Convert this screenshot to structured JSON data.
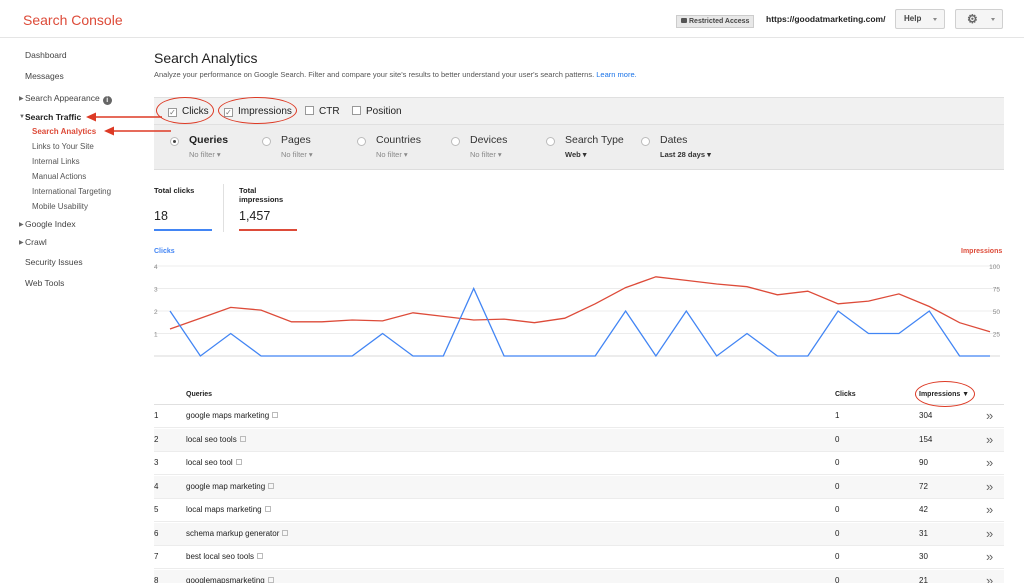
{
  "header": {
    "app_title": "Search Console",
    "restricted_label": "Restricted Access",
    "site_url": "https://goodatmarketing.com/",
    "help_label": "Help"
  },
  "sidebar": {
    "items": [
      {
        "label": "Dashboard"
      },
      {
        "label": "Messages"
      },
      {
        "label": "Search Appearance"
      },
      {
        "label": "Search Traffic"
      },
      {
        "label": "Search Analytics"
      },
      {
        "label": "Links to Your Site"
      },
      {
        "label": "Internal Links"
      },
      {
        "label": "Manual Actions"
      },
      {
        "label": "International Targeting"
      },
      {
        "label": "Mobile Usability"
      },
      {
        "label": "Google Index"
      },
      {
        "label": "Crawl"
      },
      {
        "label": "Security Issues"
      },
      {
        "label": "Web Tools"
      }
    ]
  },
  "main": {
    "title": "Search Analytics",
    "description": "Analyze your performance on Google Search. Filter and compare your site's results to better understand your user's search patterns.",
    "learn_more": "Learn more.",
    "metrics": [
      {
        "label": "Clicks",
        "checked": true
      },
      {
        "label": "Impressions",
        "checked": true
      },
      {
        "label": "CTR",
        "checked": false
      },
      {
        "label": "Position",
        "checked": false
      }
    ],
    "dimensions": [
      {
        "label": "Queries",
        "filter": "No filter",
        "selected": true
      },
      {
        "label": "Pages",
        "filter": "No filter",
        "selected": false
      },
      {
        "label": "Countries",
        "filter": "No filter",
        "selected": false
      },
      {
        "label": "Devices",
        "filter": "No filter",
        "selected": false
      },
      {
        "label": "Search Type",
        "filter": "Web",
        "selected": false
      },
      {
        "label": "Dates",
        "filter": "Last 28 days",
        "selected": false
      }
    ],
    "totals": {
      "clicks_label": "Total clicks",
      "clicks_value": "18",
      "impressions_label": "Total impressions",
      "impressions_value": "1,457"
    },
    "table": {
      "headers": {
        "queries": "Queries",
        "clicks": "Clicks",
        "impressions": "Impressions ▼"
      },
      "rows": [
        {
          "num": "1",
          "query": "google maps marketing",
          "clicks": "1",
          "impressions": "304"
        },
        {
          "num": "2",
          "query": "local seo tools",
          "clicks": "0",
          "impressions": "154"
        },
        {
          "num": "3",
          "query": "local seo tool",
          "clicks": "0",
          "impressions": "90"
        },
        {
          "num": "4",
          "query": "google map marketing",
          "clicks": "0",
          "impressions": "72"
        },
        {
          "num": "5",
          "query": "local maps marketing",
          "clicks": "0",
          "impressions": "42"
        },
        {
          "num": "6",
          "query": "schema markup generator",
          "clicks": "0",
          "impressions": "31"
        },
        {
          "num": "7",
          "query": "best local seo tools",
          "clicks": "0",
          "impressions": "30"
        },
        {
          "num": "8",
          "query": "googlemapsmarketing",
          "clicks": "0",
          "impressions": "21"
        }
      ]
    }
  },
  "colors": {
    "clicks": "#4285f4",
    "impressions": "#dd4b39",
    "accent": "#dd4b39"
  },
  "chart_data": {
    "type": "line",
    "left_axis_label": "Clicks",
    "right_axis_label": "Impressions",
    "left_ticks": [
      "4",
      "3",
      "2",
      "1"
    ],
    "right_ticks": [
      "100",
      "75",
      "50",
      "25"
    ],
    "ylim_left": [
      0,
      4
    ],
    "ylim_right": [
      0,
      100
    ],
    "series": [
      {
        "name": "Clicks",
        "axis": "left",
        "values": [
          2,
          0,
          1,
          0,
          0,
          0,
          0,
          1,
          0,
          0,
          3,
          0,
          0,
          0,
          0,
          2,
          0,
          2,
          0,
          1,
          0,
          0,
          2,
          1,
          1,
          2,
          0,
          0
        ]
      },
      {
        "name": "Impressions",
        "axis": "right",
        "values": [
          30,
          42,
          54,
          51,
          38,
          38,
          40,
          39,
          48,
          44,
          40,
          41,
          37,
          42,
          58,
          76,
          88,
          84,
          80,
          77,
          68,
          72,
          58,
          61,
          69,
          55,
          37,
          27
        ]
      }
    ]
  }
}
